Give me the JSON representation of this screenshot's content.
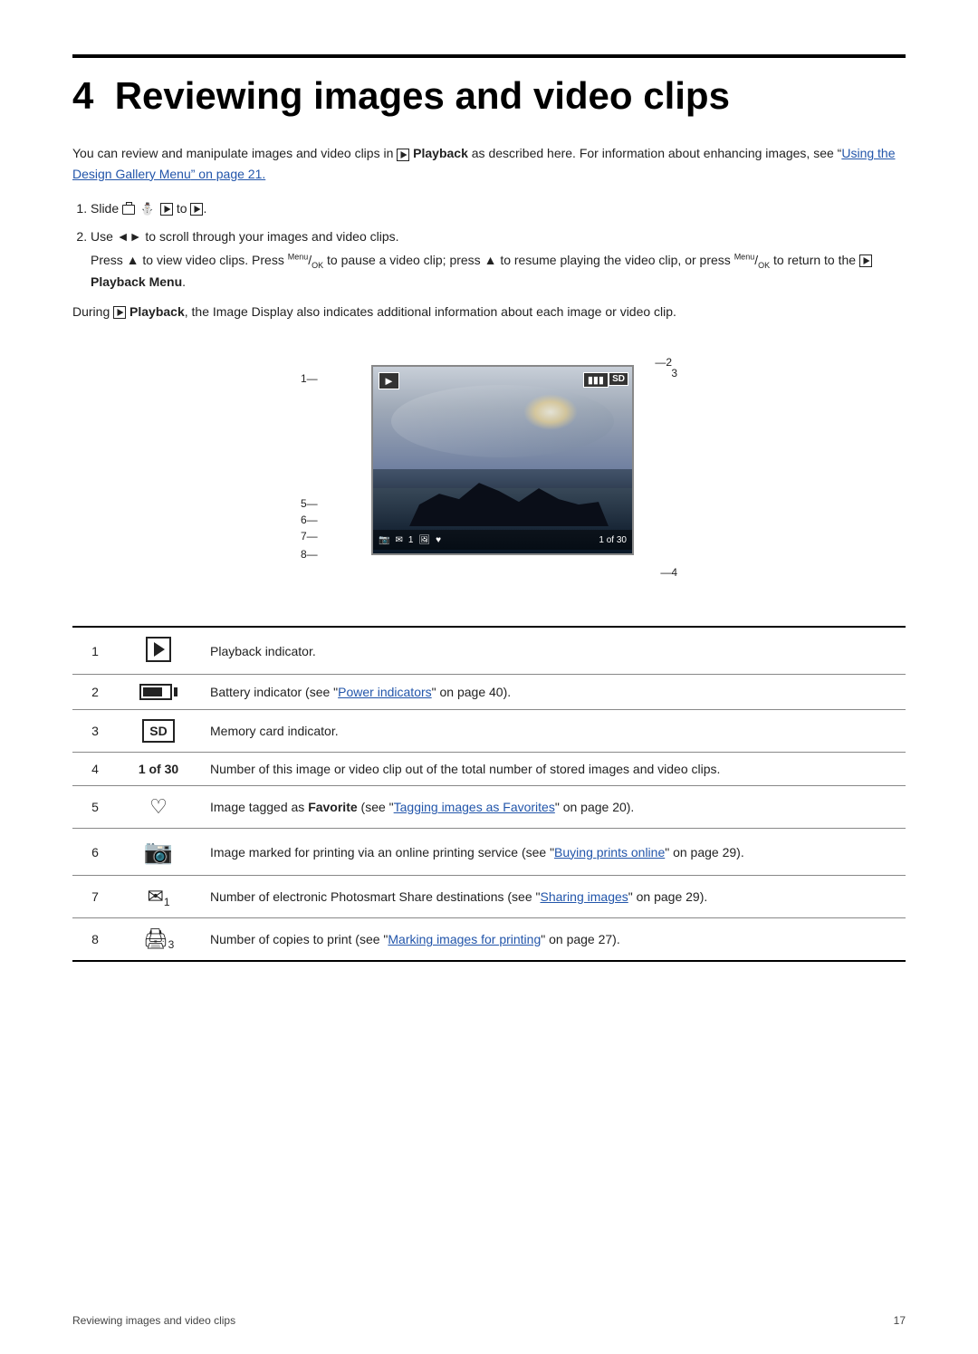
{
  "page": {
    "chapter_number": "4",
    "chapter_title": "Reviewing images and video clips",
    "intro_paragraph": "You can review and manipulate images and video clips in",
    "intro_bold": "Playback",
    "intro_rest": "as described here. For information about enhancing images, see “",
    "intro_link": "Using the Design Gallery Menu",
    "intro_link2": "” on page 21.",
    "step1_label": "1.",
    "step1_text": "Slide",
    "step1_icons": "camera scene play",
    "step1_to": "to",
    "step1_end": ".",
    "step2_label": "2.",
    "step2_text": "Use ◄► to scroll through your images and video clips.",
    "step2_sub": "Press ▲ to view video clips. Press",
    "step2_menu_ok": "Menu/OK",
    "step2_sub2": "to pause a video clip; press ▲ to resume playing the video clip, or press",
    "step2_menu_ok2": "Menu/OK",
    "step2_sub3": "to return to the",
    "step2_playback_bold": "Playback Menu",
    "step2_sub4": ".",
    "during_text": "During",
    "during_bold": "Playback",
    "during_rest": ", the Image Display also indicates additional information about each image or video clip.",
    "table": {
      "rows": [
        {
          "num": "1",
          "icon_label": "play-indicator-icon",
          "desc": "Playback indicator."
        },
        {
          "num": "2",
          "icon_label": "battery-indicator-icon",
          "desc_pre": "Battery indicator (see “",
          "desc_link": "Power indicators",
          "desc_link_ref": "on page 40",
          "desc_post": "” on page 40)."
        },
        {
          "num": "3",
          "icon_label": "sd-card-icon",
          "desc": "Memory card indicator."
        },
        {
          "num": "4",
          "icon_bold": "1 of 30",
          "icon_label": "image-count-icon",
          "desc": "Number of this image or video clip out of the total number of stored images and video clips."
        },
        {
          "num": "5",
          "icon_label": "favorite-heart-icon",
          "desc_pre": "Image tagged as ",
          "desc_bold": "Favorite",
          "desc_mid": " (see “",
          "desc_link": "Tagging images as Favorites",
          "desc_link_ref": "on page 20",
          "desc_post": "” on page 20)."
        },
        {
          "num": "6",
          "icon_label": "online-print-icon",
          "desc_pre": "Image marked for printing via an online printing service (see “",
          "desc_link": "Buying prints online",
          "desc_link_ref": "on page 29",
          "desc_post": "” on page 29)."
        },
        {
          "num": "7",
          "icon_label": "share-icon",
          "icon_num": "1",
          "desc_pre": "Number of electronic Photosmart Share destinations (see “",
          "desc_link": "Sharing images",
          "desc_link_ref": "on page 29",
          "desc_post": "” on page 29)."
        },
        {
          "num": "8",
          "icon_label": "copies-icon",
          "icon_num": "3",
          "desc_pre": "Number of copies to print (see “",
          "desc_link": "Marking images for printing",
          "desc_link_ref": "on page 27",
          "desc_post": "” on page 27)."
        }
      ]
    },
    "footer": {
      "left": "Reviewing images and video clips",
      "right": "17"
    }
  }
}
